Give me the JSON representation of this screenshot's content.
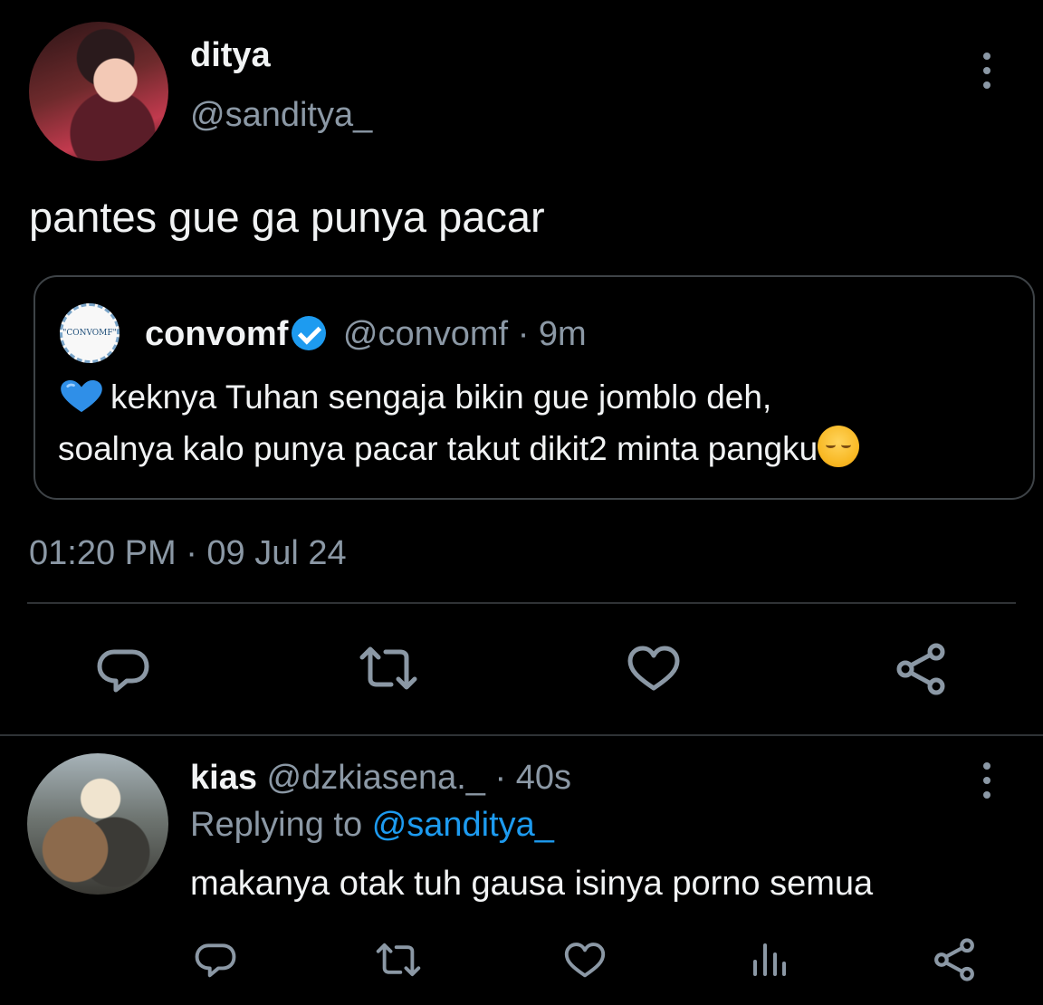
{
  "tweet": {
    "author": {
      "display_name": "ditya",
      "handle": "@sanditya_"
    },
    "text": "pantes gue ga punya pacar",
    "quote": {
      "logo_text": "\"CONVOMF\"",
      "display_name": "convomf",
      "handle": "@convomf",
      "time": "· 9m",
      "line1": "keknya Tuhan sengaja bikin gue jomblo deh,",
      "line2": "soalnya kalo punya pacar takut dikit2 minta pangku"
    },
    "timestamp": "01:20 PM · 09 Jul 24",
    "actions": [
      "reply-icon",
      "retweet-icon",
      "like-icon",
      "share-icon"
    ]
  },
  "reply": {
    "author": {
      "display_name": "kias",
      "handle": "@dzkiasena._",
      "time": "· 40s"
    },
    "replying_prefix": "Replying to",
    "replying_to": "@sanditya_",
    "text": "makanya otak tuh gausa isinya porno semua",
    "actions": [
      "reply-icon",
      "retweet-icon",
      "like-icon",
      "views-icon",
      "share-icon"
    ]
  },
  "colors": {
    "background": "#000000",
    "text": "#e7e9ea",
    "muted": "#8b98a5",
    "link": "#1d9bf0",
    "border": "#3e4347"
  }
}
